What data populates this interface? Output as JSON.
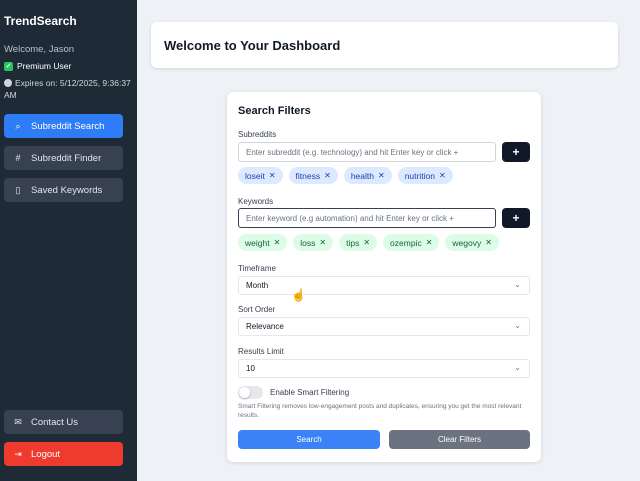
{
  "sidebar": {
    "brand": "TrendSearch",
    "welcome": "Welcome, Jason",
    "premium": "Premium User",
    "expires": "Expires on: 5/12/2025, 9:36:37 AM",
    "nav": [
      {
        "label": "Subreddit Search",
        "icon": "search-icon",
        "active": true
      },
      {
        "label": "Subreddit Finder",
        "icon": "hash-icon",
        "active": false
      },
      {
        "label": "Saved Keywords",
        "icon": "bookmark-icon",
        "active": false
      }
    ],
    "contact": "Contact Us",
    "logout": "Logout"
  },
  "header": {
    "title": "Welcome to Your Dashboard"
  },
  "filters": {
    "title": "Search Filters",
    "subreddits_label": "Subreddits",
    "subreddit_placeholder": "Enter subreddit (e.g. technology) and hit Enter key or click +",
    "subreddit_tags": [
      "loseit",
      "fitness",
      "health",
      "nutrition"
    ],
    "keywords_label": "Keywords",
    "keyword_placeholder": "Enter keyword (e.g automation) and hit Enter key or click +",
    "keyword_tags": [
      "weight",
      "loss",
      "tips",
      "ozempic",
      "wegovy"
    ],
    "timeframe_label": "Timeframe",
    "timeframe_value": "Month",
    "sort_label": "Sort Order",
    "sort_value": "Relevance",
    "limit_label": "Results Limit",
    "limit_value": "10",
    "smart_label": "Enable Smart Filtering",
    "smart_enabled": false,
    "smart_note": "Smart Filtering removes low-engagement posts and duplicates, ensuring you get the most relevant results.",
    "search_label": "Search",
    "clear_label": "Clear Filters"
  },
  "colors": {
    "sidebar": "#1f2a37",
    "accent": "#2f7df6",
    "logout": "#ef3b2d",
    "dark_button": "#111827"
  }
}
